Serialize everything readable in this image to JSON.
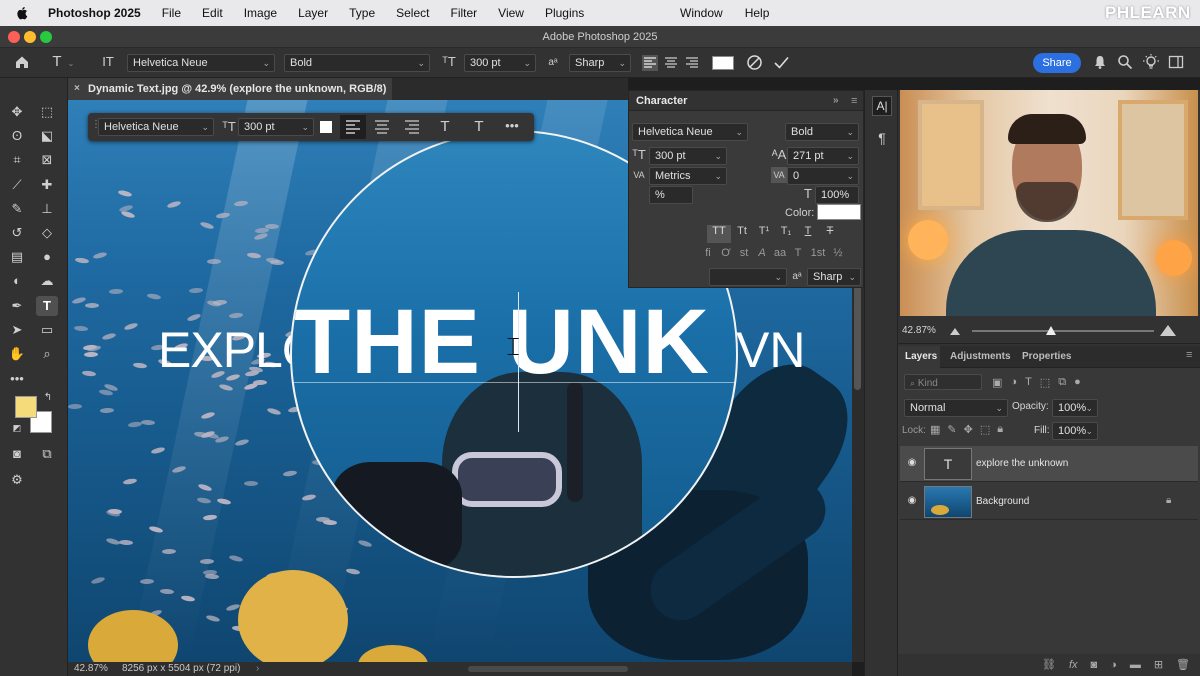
{
  "menubar": {
    "app_name": "Photoshop 2025",
    "items": [
      "File",
      "Edit",
      "Image",
      "Layer",
      "Type",
      "Select",
      "Filter",
      "View",
      "Plugins"
    ],
    "right_items": [
      "Window",
      "Help"
    ],
    "watermark": "PHLEARN"
  },
  "window": {
    "title": "Adobe Photoshop 2025"
  },
  "options_bar": {
    "font_family": "Helvetica Neue",
    "font_style": "Bold",
    "font_size": "300 pt",
    "anti_alias_label": "aᵃ",
    "anti_alias": "Sharp",
    "share_label": "Share"
  },
  "document": {
    "tab_title": "Dynamic Text.jpg @ 42.9% (explore the unknown, RGB/8) *",
    "canvas_text_left": "EXPLO",
    "canvas_text_mag": "THE UNK",
    "canvas_text_right": "VN",
    "zoom": "42.87%",
    "dimensions": "8256 px x 5504 px (72 ppi)"
  },
  "contextual_bar": {
    "font_family": "Helvetica Neue",
    "font_size": "300 pt"
  },
  "character_panel": {
    "title": "Character",
    "font_family": "Helvetica Neue",
    "font_style": "Bold",
    "font_size": "300 pt",
    "leading": "271 pt",
    "kerning": "Metrics",
    "tracking": "0",
    "vertical_scale": "%",
    "horizontal_scale": "100%",
    "color_label": "Color:",
    "style_buttons": [
      "TT",
      "Tt",
      "T¹",
      "T₁",
      "T",
      "T"
    ],
    "feature_buttons": [
      "fi",
      "Ơ",
      "st",
      "А",
      "aa",
      "T",
      "1st",
      "½"
    ],
    "aa_label": "aᵃ",
    "anti_alias": "Sharp"
  },
  "navigator": {
    "zoom": "42.87%"
  },
  "layers_panel": {
    "tabs": [
      "Layers",
      "Adjustments",
      "Properties"
    ],
    "kind_placeholder": "Kind",
    "blend_mode": "Normal",
    "opacity_label": "Opacity:",
    "opacity": "100%",
    "lock_label": "Lock:",
    "fill_label": "Fill:",
    "fill": "100%",
    "layers": [
      {
        "name": "explore the unknown",
        "type": "text",
        "thumb": "T"
      },
      {
        "name": "Background",
        "type": "image"
      }
    ]
  },
  "colors": {
    "foreground": "#f6db7a",
    "background": "#ffffff",
    "accent": "#2c6fe0"
  }
}
